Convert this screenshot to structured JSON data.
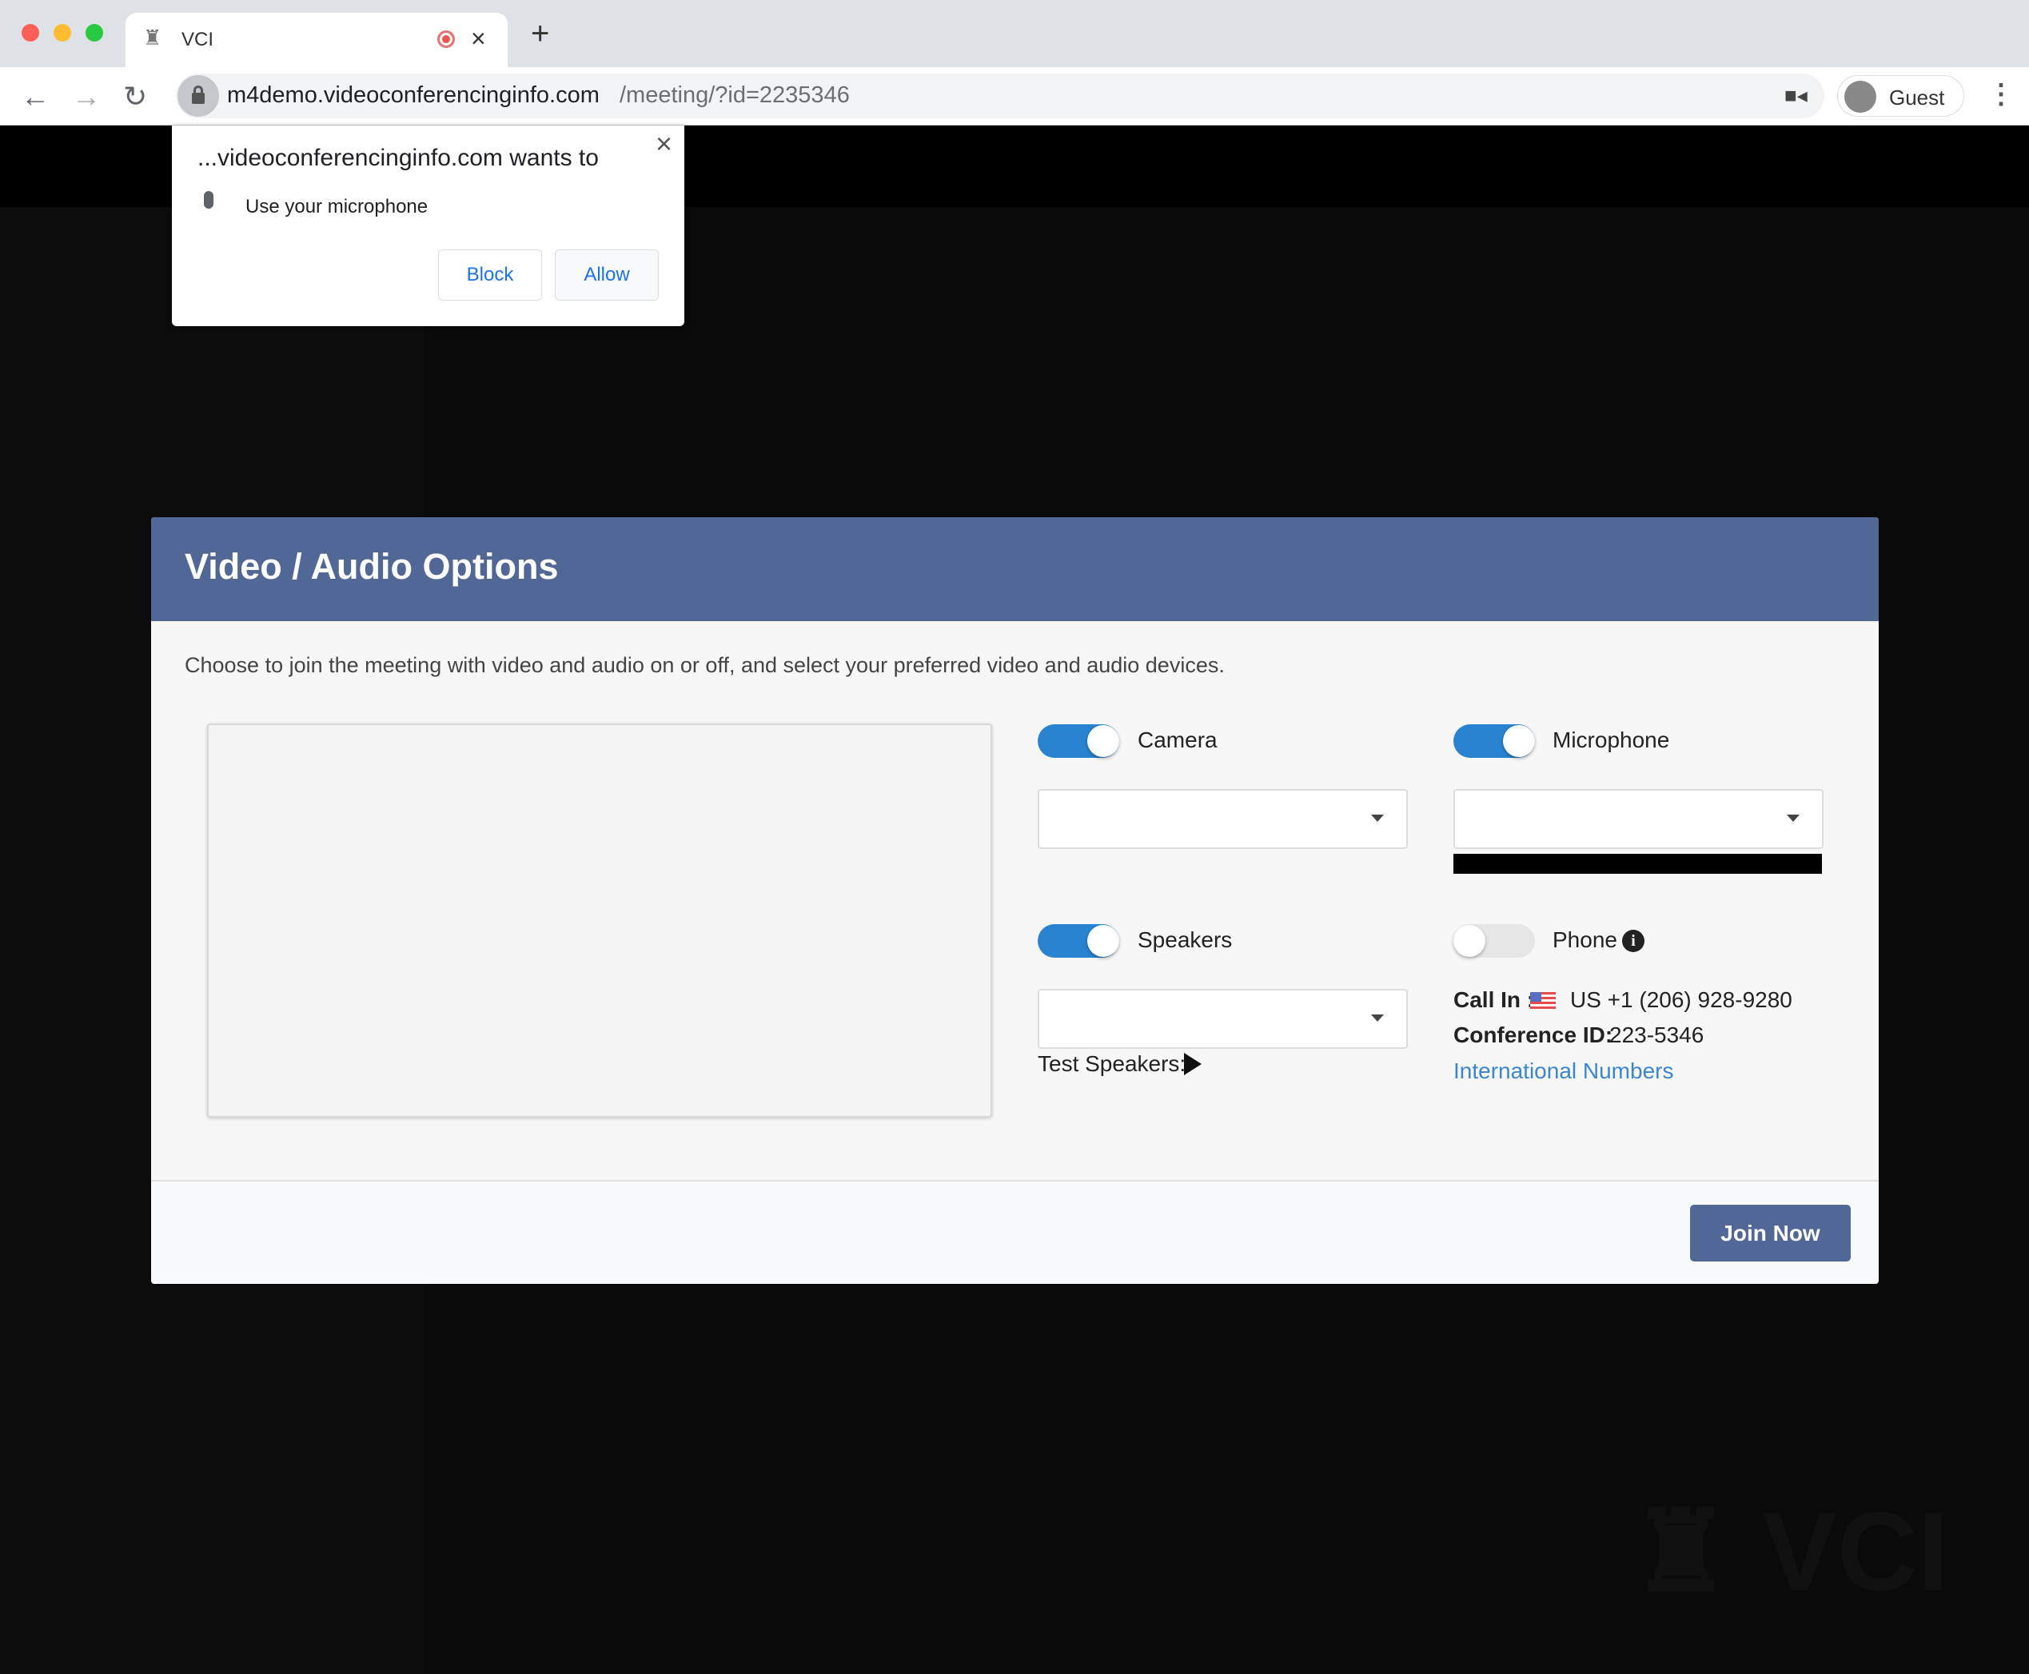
{
  "browser": {
    "tab_title": "VCI",
    "url_host": "m4demo.videoconferencinginfo.com",
    "url_path": "/meeting/?id=2235346",
    "profile_label": "Guest",
    "window_controls": {
      "close": "#ff5f57",
      "minimize": "#febc2e",
      "maximize": "#28c840"
    }
  },
  "permission_prompt": {
    "title": "...videoconferencinginfo.com wants to",
    "request": "Use your microphone",
    "block_label": "Block",
    "allow_label": "Allow",
    "close_icon": "×"
  },
  "modal": {
    "title": "Video / Audio Options",
    "description": "Choose to join the meeting with video and audio on or off, and select your preferred video and audio devices.",
    "camera": {
      "label": "Camera",
      "enabled": true,
      "selected": ""
    },
    "microphone": {
      "label": "Microphone",
      "enabled": true,
      "selected": ""
    },
    "speakers": {
      "label": "Speakers",
      "enabled": true,
      "selected": "",
      "test_label": "Test Speakers:"
    },
    "phone": {
      "label": "Phone",
      "enabled": false,
      "call_in_label": "Call In :",
      "call_in_number": "US +1 (206) 928-9280",
      "conference_id_label": "Conference ID:",
      "conference_id": "223-5346",
      "international_link": "International Numbers"
    },
    "join_label": "Join Now",
    "colors": {
      "header": "#516897",
      "toggle_on": "#2a83d0",
      "link": "#3a86d0",
      "button": "#516897"
    }
  },
  "watermark": {
    "logo_text": "VCI"
  }
}
